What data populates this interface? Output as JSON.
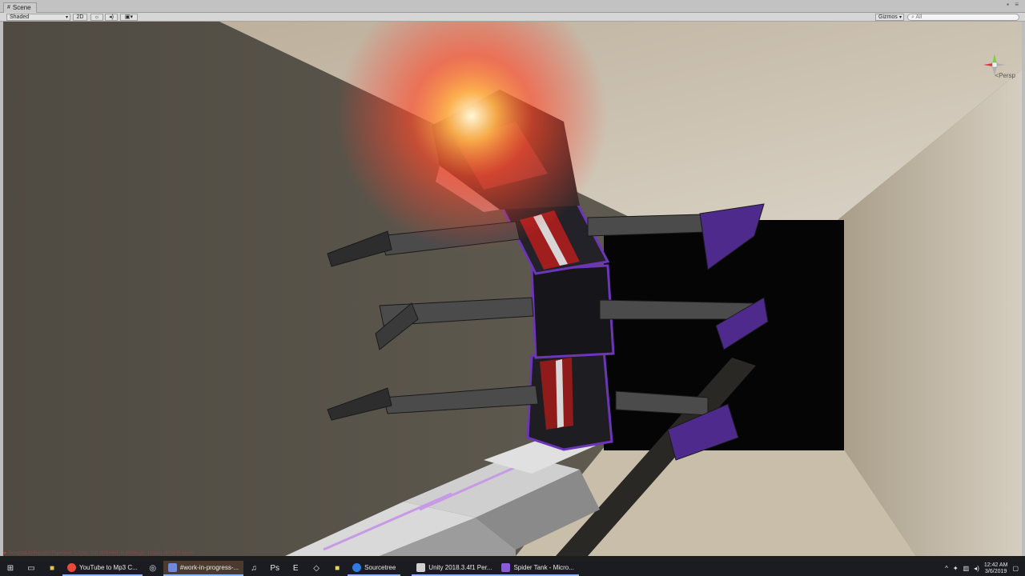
{
  "window": {
    "tab_icon": "grid-icon",
    "tab_label": "Scene"
  },
  "scene_toolbar": {
    "shading_mode": "Shaded",
    "mode_2d": "2D",
    "lighting_icon": "sun-icon",
    "audio_icon": "speaker-icon",
    "effects_icon": "image-icon",
    "gizmos_label": "Gizmos",
    "search_placeholder": "All"
  },
  "viewport": {
    "projection_label": "Persp"
  },
  "console": {
    "message": "ScriptableRenderPipeline: Layer not defined in settings. Using default layer."
  },
  "taskbar": {
    "items": [
      {
        "label": "YouTube to Mp3 C...",
        "icon": "chrome-icon",
        "color": "#e84a3b",
        "active": false,
        "open": true
      },
      {
        "label": "#work-in-progress-...",
        "icon": "discord-icon",
        "color": "#7289da",
        "active": true,
        "open": true
      },
      {
        "label": "Sourcetree",
        "icon": "sourcetree-icon",
        "color": "#2f7be0",
        "active": false,
        "open": true
      },
      {
        "label": "Unity 2018.3.4f1 Per...",
        "icon": "unity-icon",
        "color": "#d0d0d0",
        "active": false,
        "open": true
      },
      {
        "label": "Spider Tank - Micro...",
        "icon": "visual-studio-icon",
        "color": "#8a5bd6",
        "active": false,
        "open": true
      }
    ],
    "clock_time": "12:42 AM",
    "clock_date": "3/6/2019"
  },
  "colors": {
    "wall_left": "#5e5a50",
    "wall_ceiling": "#d2c8b8",
    "wall_floor": "#cfc4b0",
    "robot_accent": "#5a2fa0",
    "robot_red": "#b21d1d",
    "glow": "#ff5a2a"
  }
}
